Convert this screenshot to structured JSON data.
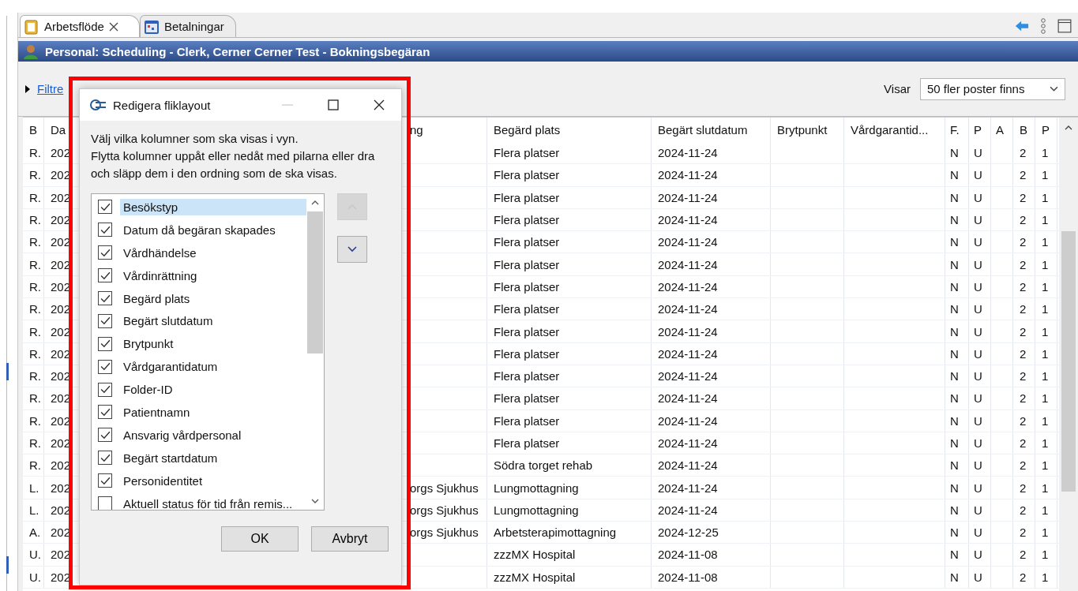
{
  "tabs": [
    {
      "label": "Arbetsflöde",
      "selected": true,
      "closable": true
    },
    {
      "label": "Betalningar",
      "selected": false,
      "closable": false
    }
  ],
  "header": {
    "title": "Personal: Scheduling - Clerk, Cerner Cerner Test - Bokningsbegäran"
  },
  "filter": {
    "link": "Filtre",
    "expanded": false
  },
  "view": {
    "label": "Visar",
    "value": "50 fler poster finns"
  },
  "table": {
    "columns": [
      "B",
      "Da",
      "ng",
      "Begärd plats",
      "Begärt slutdatum",
      "Brytpunkt",
      "Vårdgarantid...",
      "F.",
      "P",
      "A",
      "B",
      "P"
    ],
    "rows": [
      [
        "R.",
        "202",
        "",
        "Flera platser",
        "2024-11-24",
        "",
        "",
        "N",
        "U",
        "",
        "2",
        "1"
      ],
      [
        "R.",
        "202",
        "",
        "Flera platser",
        "2024-11-24",
        "",
        "",
        "N",
        "U",
        "",
        "2",
        "1"
      ],
      [
        "R.",
        "202",
        "",
        "Flera platser",
        "2024-11-24",
        "",
        "",
        "N",
        "U",
        "",
        "2",
        "1"
      ],
      [
        "R.",
        "202",
        "",
        "Flera platser",
        "2024-11-24",
        "",
        "",
        "N",
        "U",
        "",
        "2",
        "1"
      ],
      [
        "R.",
        "202",
        "",
        "Flera platser",
        "2024-11-24",
        "",
        "",
        "N",
        "U",
        "",
        "2",
        "1"
      ],
      [
        "R.",
        "202",
        "",
        "Flera platser",
        "2024-11-24",
        "",
        "",
        "N",
        "U",
        "",
        "2",
        "1"
      ],
      [
        "R.",
        "202",
        "",
        "Flera platser",
        "2024-11-24",
        "",
        "",
        "N",
        "U",
        "",
        "2",
        "1"
      ],
      [
        "R.",
        "202",
        "",
        "Flera platser",
        "2024-11-24",
        "",
        "",
        "N",
        "U",
        "",
        "2",
        "1"
      ],
      [
        "R.",
        "202",
        "",
        "Flera platser",
        "2024-11-24",
        "",
        "",
        "N",
        "U",
        "",
        "2",
        "1"
      ],
      [
        "R.",
        "202",
        "",
        "Flera platser",
        "2024-11-24",
        "",
        "",
        "N",
        "U",
        "",
        "2",
        "1"
      ],
      [
        "R.",
        "202",
        "",
        "Flera platser",
        "2024-11-24",
        "",
        "",
        "N",
        "U",
        "",
        "2",
        "1"
      ],
      [
        "R.",
        "202",
        "",
        "Flera platser",
        "2024-11-24",
        "",
        "",
        "N",
        "U",
        "",
        "2",
        "1"
      ],
      [
        "R.",
        "202",
        "",
        "Flera platser",
        "2024-11-24",
        "",
        "",
        "N",
        "U",
        "",
        "2",
        "1"
      ],
      [
        "R.",
        "202",
        "",
        "Flera platser",
        "2024-11-24",
        "",
        "",
        "N",
        "U",
        "",
        "2",
        "1"
      ],
      [
        "R.",
        "202",
        "",
        "Södra torget rehab",
        "2024-11-24",
        "",
        "",
        "N",
        "U",
        "",
        "2",
        "1"
      ],
      [
        "L.",
        "202",
        "orgs Sjukhus",
        "Lungmottagning",
        "2024-11-24",
        "",
        "",
        "N",
        "U",
        "",
        "2",
        "1"
      ],
      [
        "L.",
        "202",
        "orgs Sjukhus",
        "Lungmottagning",
        "2024-11-24",
        "",
        "",
        "N",
        "U",
        "",
        "2",
        "1"
      ],
      [
        "A.",
        "202",
        "orgs Sjukhus",
        "Arbetsterapimottagning",
        "2024-12-25",
        "",
        "",
        "N",
        "U",
        "",
        "2",
        "1"
      ],
      [
        "U.",
        "202",
        "",
        "zzzMX Hospital",
        "2024-11-08",
        "",
        "",
        "N",
        "U",
        "",
        "2",
        "1"
      ],
      [
        "U.",
        "202",
        "",
        "zzzMX Hospital",
        "2024-11-08",
        "",
        "",
        "N",
        "U",
        "",
        "2",
        "1"
      ]
    ]
  },
  "dialog": {
    "title": "Redigera fliklayout",
    "description": [
      "Välj vilka kolumner som ska visas i vyn.",
      "Flytta kolumner uppåt eller nedåt med pilarna eller dra och släpp dem i den ordning som de ska visas."
    ],
    "columns": [
      {
        "label": "Besökstyp",
        "checked": true,
        "selected": true
      },
      {
        "label": "Datum då begäran skapades",
        "checked": true,
        "selected": false
      },
      {
        "label": "Vårdhändelse",
        "checked": true,
        "selected": false
      },
      {
        "label": "Vårdinrättning",
        "checked": true,
        "selected": false
      },
      {
        "label": "Begärd plats",
        "checked": true,
        "selected": false
      },
      {
        "label": "Begärt slutdatum",
        "checked": true,
        "selected": false
      },
      {
        "label": "Brytpunkt",
        "checked": true,
        "selected": false
      },
      {
        "label": "Vårdgarantidatum",
        "checked": true,
        "selected": false
      },
      {
        "label": "Folder-ID",
        "checked": true,
        "selected": false
      },
      {
        "label": "Patientnamn",
        "checked": true,
        "selected": false
      },
      {
        "label": "Ansvarig vårdpersonal",
        "checked": true,
        "selected": false
      },
      {
        "label": "Begärt startdatum",
        "checked": true,
        "selected": false
      },
      {
        "label": "Personidentitet",
        "checked": true,
        "selected": false
      },
      {
        "label": "Aktuell status för tid från remis...",
        "checked": false,
        "selected": false
      }
    ],
    "move_up_disabled": true,
    "move_down_disabled": false,
    "buttons": [
      "OK",
      "Avbryt"
    ]
  }
}
